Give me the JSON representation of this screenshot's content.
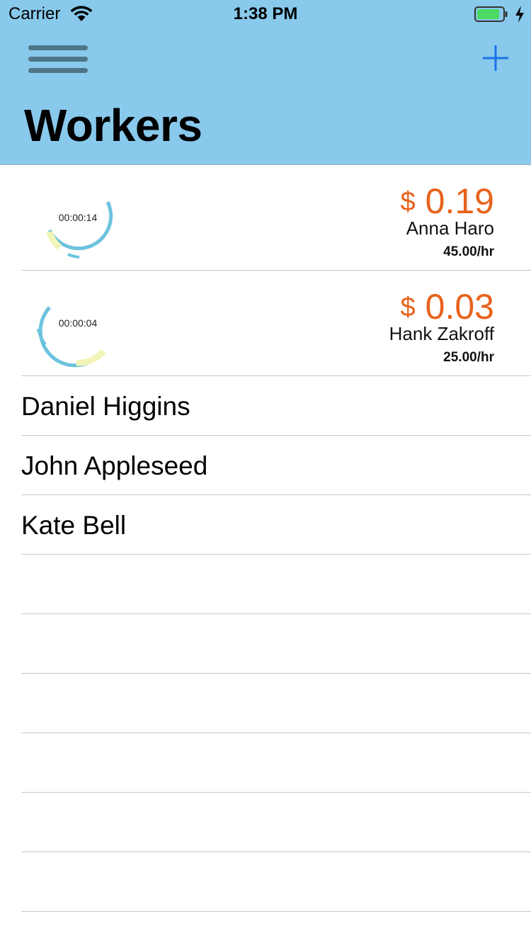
{
  "status_bar": {
    "carrier": "Carrier",
    "time": "1:38 PM",
    "battery_color": "#4cd964"
  },
  "nav": {
    "menu_icon": "hamburger-menu-icon",
    "add_icon": "plus-icon",
    "title": "Workers",
    "background": "#88c9ec",
    "tint": "#1a73e8"
  },
  "active_workers": [
    {
      "timer": "00:00:14",
      "currency": "$",
      "amount": "0.19",
      "name": "Anna Haro",
      "rate": "45.00/hr"
    },
    {
      "timer": "00:00:04",
      "currency": "$",
      "amount": "0.03",
      "name": "Hank Zakroff",
      "rate": "25.00/hr"
    }
  ],
  "workers": [
    "Daniel Higgins",
    "John Appleseed",
    "Kate Bell"
  ],
  "colors": {
    "accent_orange": "#e8621c",
    "ring_blue": "#6cc3de",
    "ring_yellow": "#f2f5b8"
  }
}
